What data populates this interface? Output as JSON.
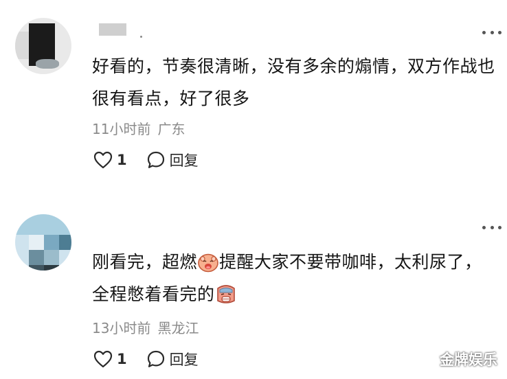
{
  "comments": [
    {
      "text": "好看的，节奏很清晰，没有多余的煽情，双方作战也很有看点，好了很多",
      "time": "11小时前",
      "location": "广东",
      "likes": "1",
      "reply_label": "回复",
      "more_icon": "more-dots-icon"
    },
    {
      "text_a": "刚看完，超燃",
      "text_b": "提醒大家不要带咖啡，太利尿了，全程憋着看完的",
      "time": "13小时前",
      "location": "黑龙江",
      "likes": "1",
      "reply_label": "回复",
      "emoji_1": "laughing-face-emoji",
      "emoji_2": "crying-face-emoji"
    }
  ],
  "watermark": "金牌娱乐",
  "colors": {
    "meta": "#8a8a8a",
    "text": "#151515",
    "watermark": "#ffffff"
  }
}
